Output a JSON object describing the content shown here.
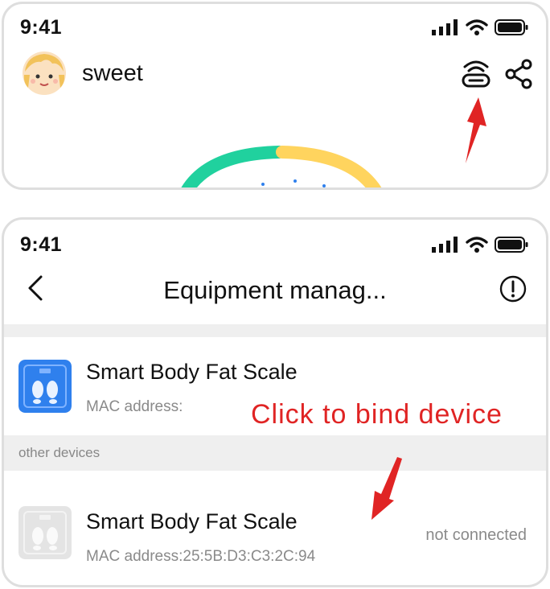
{
  "top_screen": {
    "status_time": "9:41",
    "username": "sweet"
  },
  "bottom_screen": {
    "status_time": "9:41",
    "title": "Equipment manag...",
    "bound_device": {
      "name": "Smart Body Fat Scale",
      "mac_label": "MAC address:"
    },
    "section_label": "other devices",
    "other_device": {
      "name": "Smart Body Fat Scale",
      "mac_label": "MAC address:25:5B:D3:C3:2C:94",
      "status": "not connected"
    }
  },
  "annotation_text": "Click to bind device",
  "colors": {
    "accent_blue": "#2f80ed",
    "annotation_red": "#e02424",
    "gauge_green": "#20d19e",
    "gauge_yellow": "#ffd45e"
  }
}
